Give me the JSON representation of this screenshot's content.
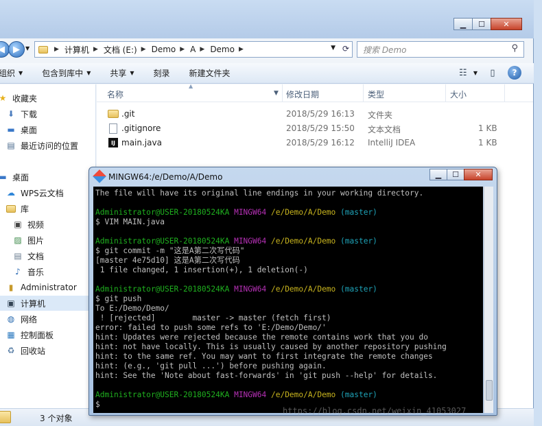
{
  "explorer": {
    "address": [
      "计算机",
      "文档 (E:)",
      "Demo",
      "A",
      "Demo"
    ],
    "search_placeholder": "搜索 Demo",
    "toolbar": [
      "组织",
      "包含到库中",
      "共享",
      "刻录",
      "新建文件夹"
    ],
    "sidebar": {
      "favorites": "收藏夹",
      "downloads": "下载",
      "desktop": "桌面",
      "recent": "最近访问的位置",
      "desktop2": "桌面",
      "wps": "WPS云文档",
      "library": "库",
      "video": "视频",
      "pictures": "图片",
      "documents": "文档",
      "music": "音乐",
      "admin": "Administrator",
      "computer": "计算机",
      "network": "网络",
      "control": "控制面板",
      "recycle": "回收站"
    },
    "columns": {
      "name": "名称",
      "date": "修改日期",
      "type": "类型",
      "size": "大小"
    },
    "files": [
      {
        "name": ".git",
        "date": "2018/5/29 16:13",
        "type": "文件夹",
        "size": ""
      },
      {
        "name": ".gitignore",
        "date": "2018/5/29 15:50",
        "type": "文本文档",
        "size": "1 KB"
      },
      {
        "name": "main.java",
        "date": "2018/5/29 16:12",
        "type": "IntelliJ IDEA",
        "size": "1 KB"
      }
    ],
    "status": "3 个对象"
  },
  "terminal": {
    "title": "MINGW64:/e/Demo/A/Demo",
    "prompt_user": "Administrator@USER-20180524KA",
    "prompt_env": "MINGW64",
    "prompt_path": "/e/Demo/A/Demo",
    "prompt_branch": "(master)",
    "line_top": "The file will have its original line endings in your working directory.",
    "cmd1": "$ VIM MAIN.java",
    "cmd2": "$ git commit -m \"这是A第二次写代码\"",
    "out2a": "[master 4e75d10] 这是A第二次写代码",
    "out2b": " 1 file changed, 1 insertion(+), 1 deletion(-)",
    "cmd3": "$ git push",
    "out3": [
      "To E:/Demo/Demo/",
      " ! [rejected]        master -> master (fetch first)",
      "error: failed to push some refs to 'E:/Demo/Demo/'",
      "hint: Updates were rejected because the remote contains work that you do",
      "hint: not have locally. This is usually caused by another repository pushing",
      "hint: to the same ref. You may want to first integrate the remote changes",
      "hint: (e.g., 'git pull ...') before pushing again.",
      "hint: See the 'Note about fast-forwards' in 'git push --help' for details."
    ],
    "cursor": "$"
  },
  "watermark": "https://blog.csdn.net/weixin_41053027"
}
